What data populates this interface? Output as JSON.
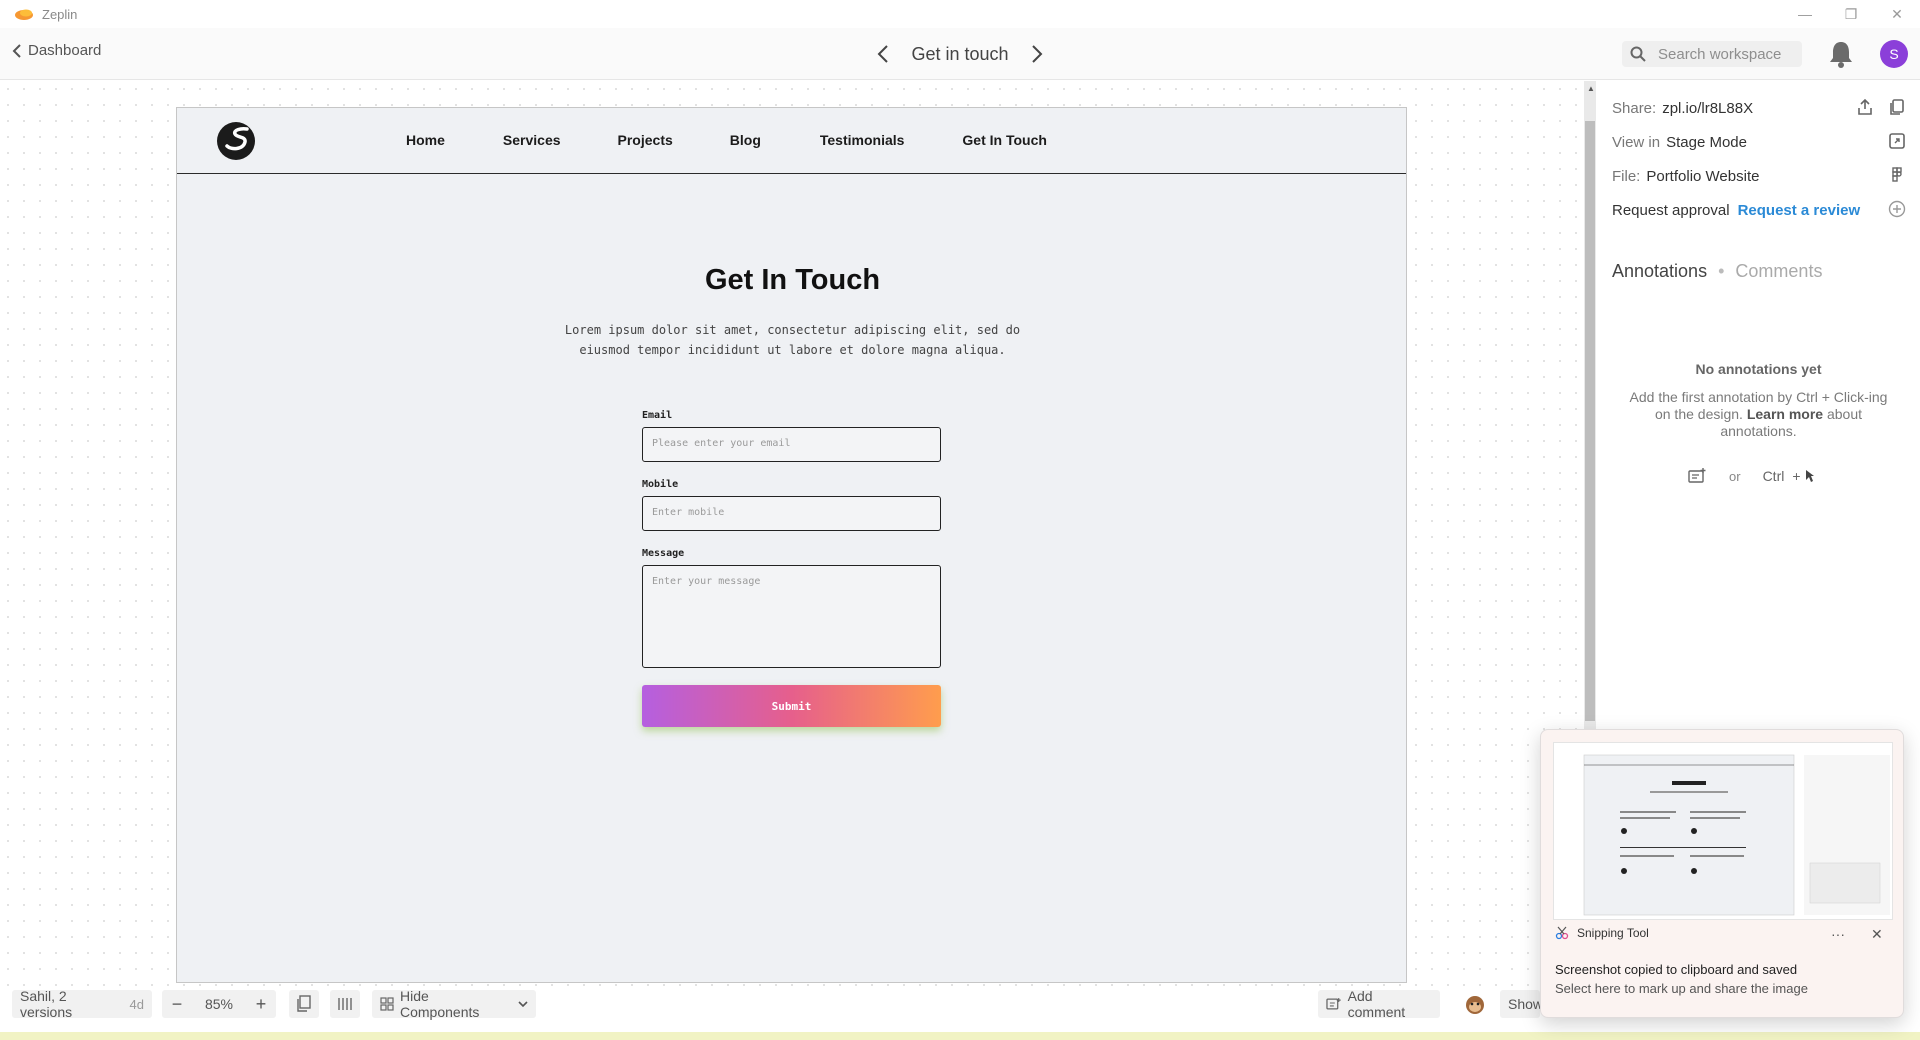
{
  "window": {
    "app_name": "Zeplin"
  },
  "header": {
    "back_label": "Dashboard",
    "screen_title": "Get in touch",
    "search_placeholder": "Search workspace",
    "avatar_letter": "S"
  },
  "artboard": {
    "nav": [
      "Home",
      "Services",
      "Projects",
      "Blog",
      "Testimonials",
      "Get In Touch"
    ],
    "heading": "Get In Touch",
    "description_line1": "Lorem ipsum dolor sit amet, consectetur adipiscing elit, sed do",
    "description_line2": "eiusmod tempor incididunt ut labore et dolore magna aliqua.",
    "email_label": "Email",
    "email_placeholder": "Please enter your email",
    "mobile_label": "Mobile",
    "mobile_placeholder": "Enter mobile",
    "message_label": "Message",
    "message_placeholder": "Enter your message",
    "submit_label": "Submit"
  },
  "panel": {
    "share_label": "Share:",
    "share_url": "zpl.io/lr8L88X",
    "view_label": "View in",
    "view_value": "Stage Mode",
    "file_label": "File:",
    "file_value": "Portfolio Website",
    "approval_label": "Request approval",
    "approval_link": "Request a review",
    "tab_annotations": "Annotations",
    "tab_comments": "Comments",
    "empty_title": "No annotations yet",
    "empty_desc_pre": "Add the first annotation by Ctrl + Click-ing on the design.",
    "empty_desc_link": "Learn more",
    "empty_desc_post": "about annotations.",
    "or_label": "or",
    "ctrl_label": "Ctrl",
    "plus_label": "+"
  },
  "bottombar": {
    "versions_label": "Sahil, 2 versions",
    "versions_age": "4d",
    "zoom": "85%",
    "minus": "−",
    "plus": "+",
    "hide_components": "Hide Components",
    "add_comment": "Add comment",
    "show_label": "Show"
  },
  "toast": {
    "app_name": "Snipping Tool",
    "title": "Screenshot copied to clipboard and saved",
    "subtitle": "Select here to mark up and share the image",
    "more": "···",
    "close": "✕"
  },
  "colors": {
    "accent": "#2b8ad6",
    "avatar": "#8b3fd9",
    "submit_gradient_start": "#b55fe0",
    "submit_gradient_end": "#ff9d4d"
  }
}
